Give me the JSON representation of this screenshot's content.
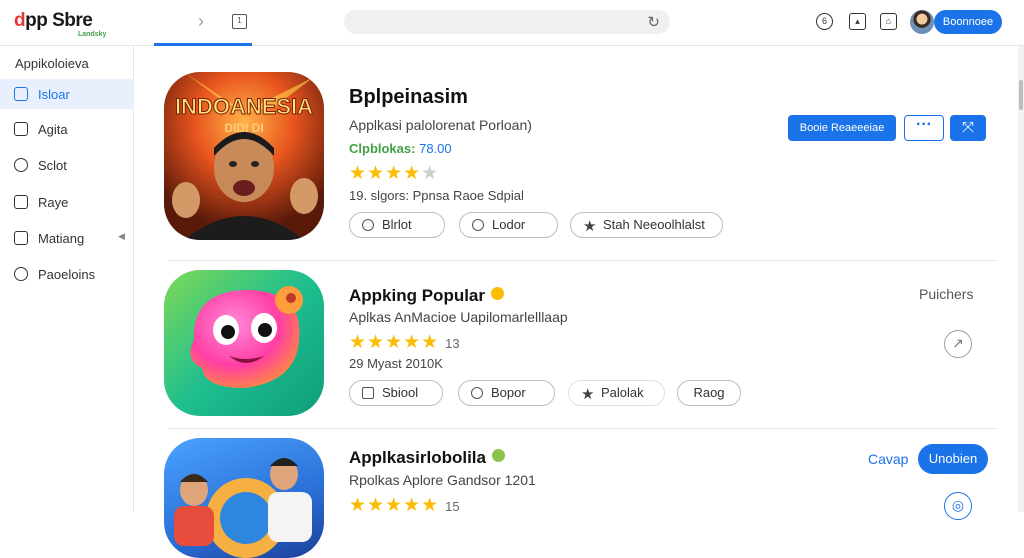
{
  "header": {
    "logo_main": "pp Sbre",
    "logo_prefix": "d",
    "logo_sub": "Landsky",
    "signin_label": "Boonnoee",
    "icons": [
      "back-forward-icon",
      "tab-icon",
      "reload-icon",
      "history-icon",
      "download-icon",
      "home-icon"
    ]
  },
  "sidebar": {
    "heading": "Appikoloieva",
    "items": [
      {
        "label": "Isloar",
        "icon": "store-icon"
      },
      {
        "label": "Agita",
        "icon": "apps-icon"
      },
      {
        "label": "Sclot",
        "icon": "chat-icon"
      },
      {
        "label": "Raye",
        "icon": "list-icon"
      },
      {
        "label": "Matiang",
        "icon": "bag-icon",
        "caret": "◀"
      },
      {
        "label": "Paoeloins",
        "icon": "settings-icon"
      }
    ]
  },
  "apps": [
    {
      "title": "Bplpeinasim",
      "subtitle": "Applkasi palolorenat Porloan)",
      "developer": "Clpblokas:",
      "price": "78.00",
      "rating_stars": 4,
      "rating_count": "",
      "meta": "19. slgors: Ppnsa Raoe Sdpial",
      "icon_text": "INDOANESIA",
      "icon_subtext": "DIDI        DI",
      "chips": [
        {
          "label": "Blrlot",
          "icon": "pin-icon"
        },
        {
          "label": "Lodor",
          "icon": "link-icon"
        },
        {
          "label": "Stah Neeoolhlalst",
          "icon": "star-icon"
        }
      ],
      "primary_button": "Booie Reaeeeiae",
      "more_button": "···",
      "share_button": "⤧"
    },
    {
      "title": "Appking Popular",
      "subtitle": "Aplkas AnMacioe Uapilomarlelllaap",
      "rating_stars": 5,
      "rating_count": "13",
      "meta": "29 Myast 2010K",
      "chips": [
        {
          "label": "Sbiool",
          "icon": "box-icon"
        },
        {
          "label": "Bopor",
          "icon": "bookmark-icon"
        },
        {
          "label": "Palolak",
          "icon": "star-icon"
        },
        {
          "label": "Raog",
          "icon": ""
        }
      ],
      "side_link": "Puichers",
      "side_icon": "share-icon"
    },
    {
      "title": "Applkasirlobolila",
      "subtitle": "Rpolkas Aplore Gandsor 1201",
      "rating_stars": 5,
      "rating_count": "15",
      "side_link": "Cavap",
      "pill_button": "Unobien",
      "side_icon": "globe-icon"
    }
  ]
}
